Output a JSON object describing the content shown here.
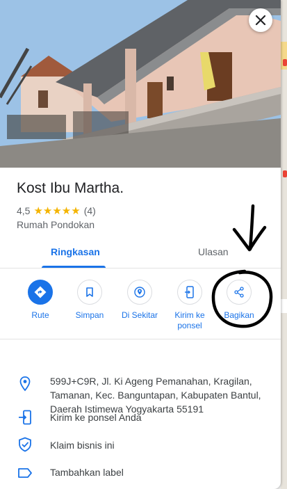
{
  "place": {
    "name": "Kost Ibu Martha.",
    "rating": "4,5",
    "stars": "★★★★★",
    "review_count": "(4)",
    "category": "Rumah Pondokan"
  },
  "tabs": [
    {
      "label": "Ringkasan"
    },
    {
      "label": "Ulasan"
    }
  ],
  "actions": [
    {
      "label": "Rute",
      "icon": "directions-icon"
    },
    {
      "label": "Simpan",
      "icon": "bookmark-icon"
    },
    {
      "label": "Di Sekitar",
      "icon": "nearby-icon"
    },
    {
      "label": "Kirim ke ponsel",
      "icon": "send-to-phone-icon"
    },
    {
      "label": "Bagikan",
      "icon": "share-icon"
    }
  ],
  "details": [
    {
      "text": "599J+C9R, Jl. Ki Ageng Pemanahan, Kragilan, Tamanan, Kec. Banguntapan, Kabupaten Bantul, Daerah Istimewa Yogyakarta 55191",
      "icon": "location-pin-icon"
    },
    {
      "text": "Kirim ke ponsel Anda",
      "icon": "send-to-phone-icon"
    },
    {
      "text": "Klaim bisnis ini",
      "icon": "verified-shield-icon"
    },
    {
      "text": "Tambahkan label",
      "icon": "label-icon"
    }
  ],
  "colors": {
    "accent": "#1a73e8",
    "star": "#f4b400",
    "annotation": "#000000"
  }
}
